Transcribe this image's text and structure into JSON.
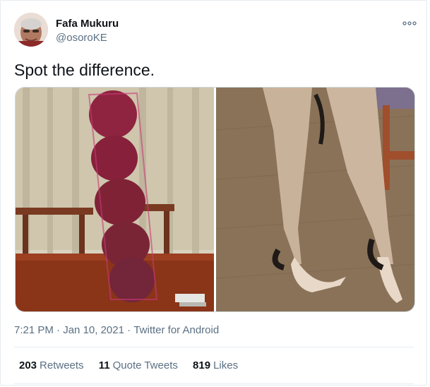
{
  "tweet": {
    "author_name": "Fafa Mukuru",
    "author_handle": "@osoroKE",
    "text": "Spot the difference.",
    "time": "7:21 PM",
    "date": "Jan 10, 2021",
    "separator": "·",
    "source": "Twitter for Android"
  },
  "stats": {
    "retweets_count": "203",
    "retweets_label": "Retweets",
    "quotes_count": "11",
    "quotes_label": "Quote Tweets",
    "likes_count": "819",
    "likes_label": "Likes"
  },
  "icons": {
    "more": "more-options-icon"
  },
  "colors": {
    "text_primary": "#0f1419",
    "text_secondary": "#5b7083",
    "divider": "#e6ecf0"
  }
}
